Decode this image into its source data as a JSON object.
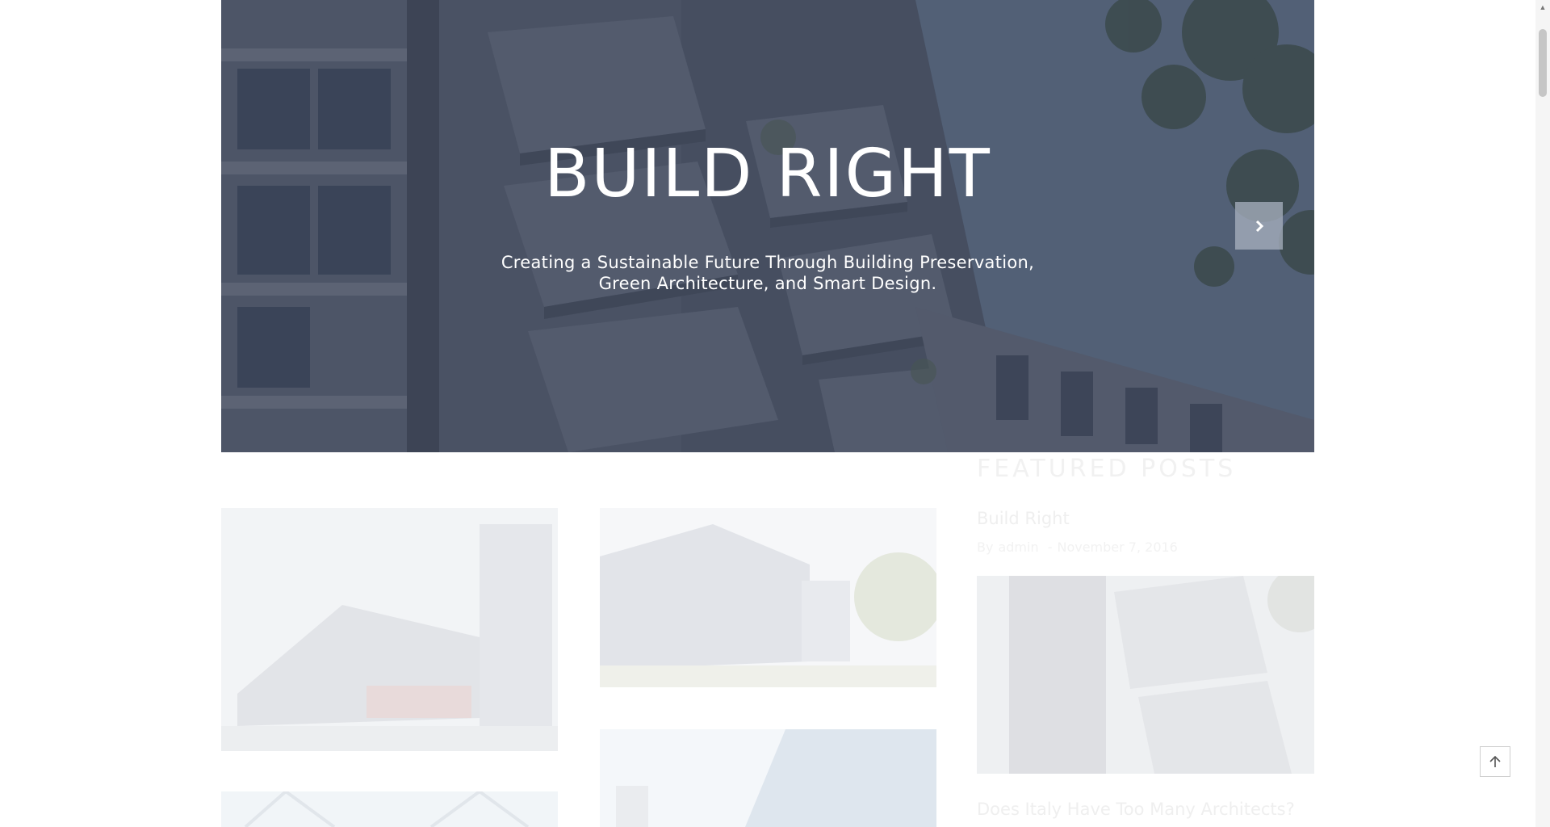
{
  "hero": {
    "title": "BUILD RIGHT",
    "subtitle_line1": "Creating a Sustainable Future Through Building Preservation,",
    "subtitle_line2": "Green Architecture, and Smart Design.",
    "next_icon": "chevron-right-icon"
  },
  "sidebar": {
    "heading": "FEATURED POSTS",
    "posts": [
      {
        "title": "Build Right",
        "by": "By",
        "author": "admin",
        "separator": "-",
        "date": "November 7, 2016"
      },
      {
        "title": "Does Italy Have Too Many Architects?"
      }
    ]
  },
  "back_to_top_icon": "arrow-up-icon",
  "colors": {
    "hero_overlay": "#4f5d72",
    "accent_faded": "#f1f1f1"
  }
}
